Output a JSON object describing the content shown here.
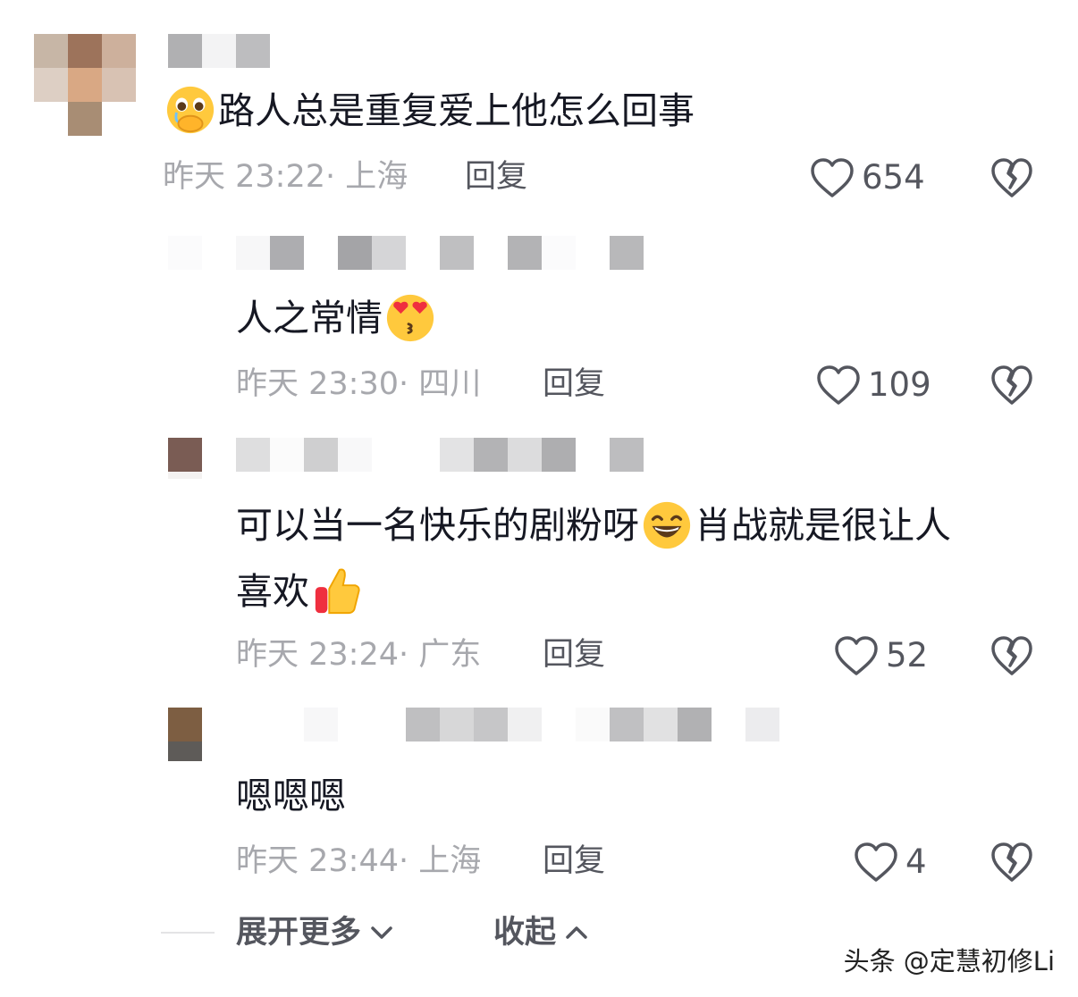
{
  "comments": [
    {
      "text": "路人总是重复爱上他怎么回事",
      "emoji_lead": "pleading-hands-icon",
      "time": "昨天 23:22",
      "location": "上海",
      "reply_label": "回复",
      "likes": "654"
    },
    {
      "text": "人之常情",
      "emoji_trail": "kissing-heart-eyes-icon",
      "time": "昨天 23:30",
      "location": "四川",
      "reply_label": "回复",
      "likes": "109"
    },
    {
      "text_line1_a": "可以当一名快乐的剧粉呀",
      "text_line1_b": "肖战就是很让人",
      "text_line2": "喜欢",
      "time": "昨天 23:24",
      "location": "广东",
      "reply_label": "回复",
      "likes": "52"
    },
    {
      "text": "嗯嗯嗯",
      "time": "昨天 23:44",
      "location": "上海",
      "reply_label": "回复",
      "likes": "4"
    }
  ],
  "footer": {
    "expand_label": "展开更多",
    "collapse_label": "收起"
  },
  "watermark": "头条 @定慧初修Li",
  "colors": {
    "text": "#161823",
    "meta": "#a7a8ad",
    "action": "#54565e"
  }
}
